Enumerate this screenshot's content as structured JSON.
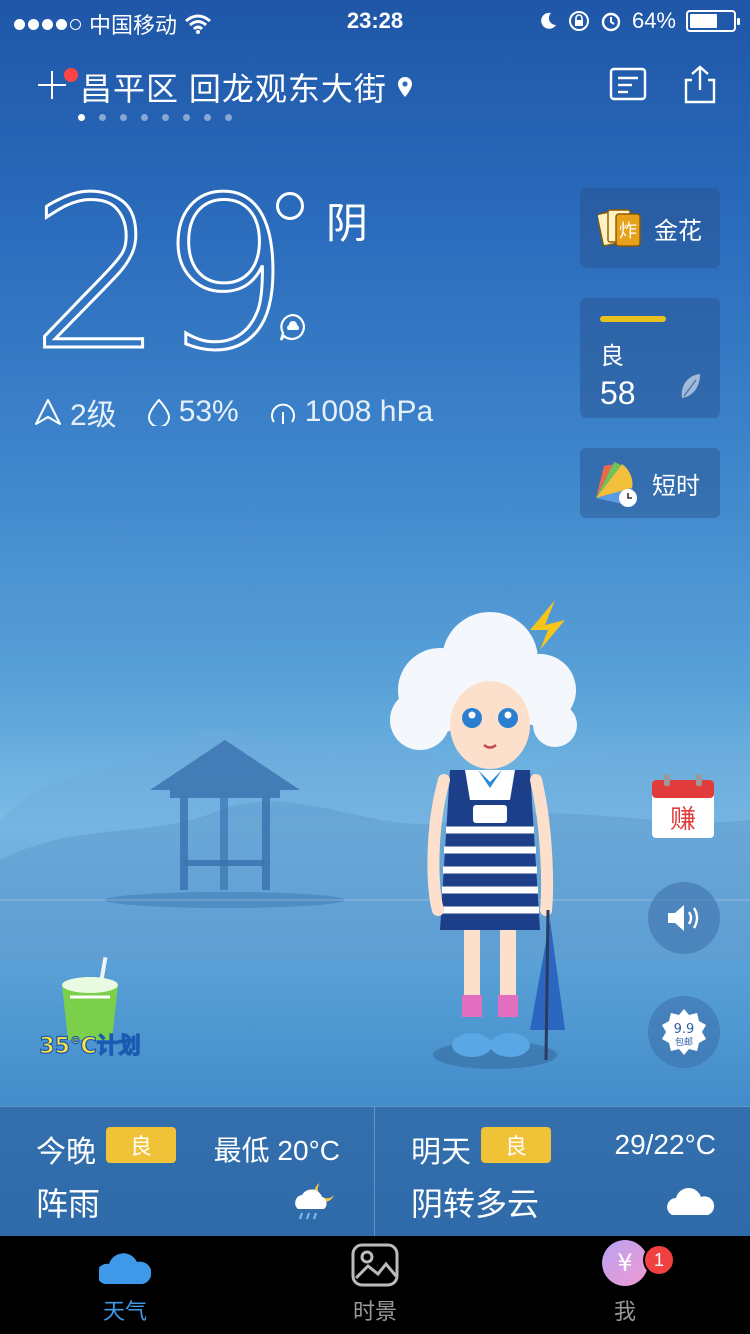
{
  "status_bar": {
    "carrier": "中国移动",
    "time": "23:28",
    "battery": "64%",
    "battery_level": 0.64
  },
  "header": {
    "location": "昌平区 回龙观东大街",
    "pages": 8,
    "active_page": 0
  },
  "current": {
    "temperature": "29",
    "condition": "阴",
    "wind": "2级",
    "humidity": "53%",
    "pressure": "1008 hPa"
  },
  "cards": {
    "game_label": "金花",
    "game_icon_text": "炸",
    "aqi_level": "良",
    "aqi_value": "58",
    "aqi_color": "#e8c21c",
    "short_label": "短时"
  },
  "side": {
    "earn_label": "赚",
    "promo_price": "9.9",
    "promo_sub": "包邮",
    "plan_label": "35℃计划"
  },
  "forecast": {
    "tonight": {
      "day": "今晚",
      "aqi": "良",
      "temp": "最低 20°C",
      "desc": "阵雨"
    },
    "tomorrow": {
      "day": "明天",
      "aqi": "良",
      "temp": "29/22°C",
      "desc": "阴转多云"
    },
    "badge_color": "#f0c238"
  },
  "tabs": [
    {
      "label": "天气",
      "icon": "cloud-icon",
      "active": true
    },
    {
      "label": "时景",
      "icon": "image-icon",
      "active": false
    },
    {
      "label": "我",
      "icon": "yuan-icon",
      "active": false,
      "badge": "1"
    }
  ]
}
